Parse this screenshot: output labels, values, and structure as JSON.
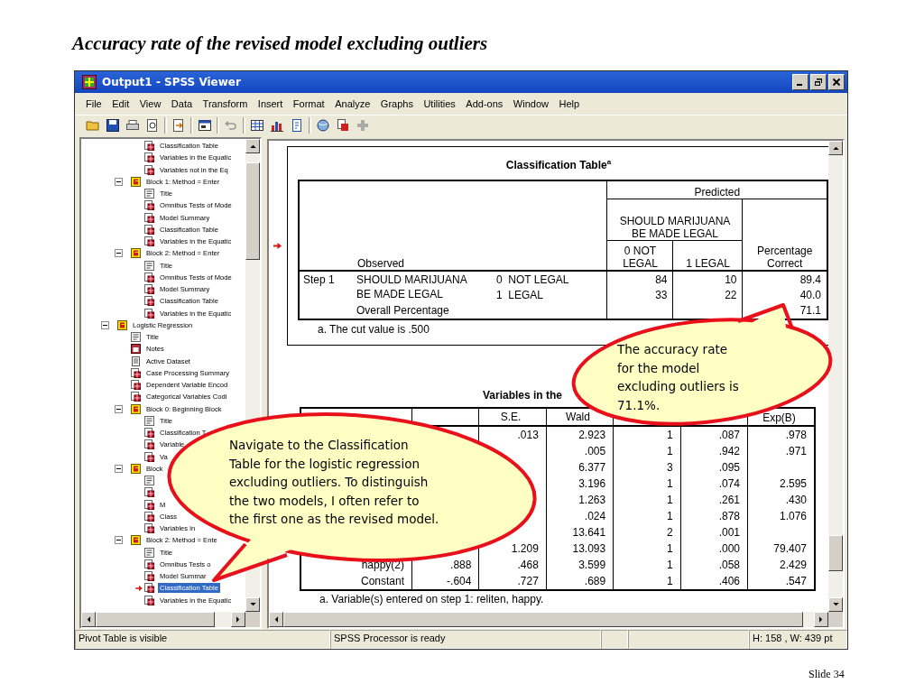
{
  "slide": {
    "title": "Accuracy rate of the revised model excluding outliers",
    "number": "Slide 34"
  },
  "window": {
    "title": "Output1 - SPSS Viewer"
  },
  "menu": [
    "File",
    "Edit",
    "View",
    "Data",
    "Transform",
    "Insert",
    "Format",
    "Analyze",
    "Graphs",
    "Utilities",
    "Add-ons",
    "Window",
    "Help"
  ],
  "tree": {
    "nodes": [
      {
        "children": [
          {
            "children": [
              {
                "kind": "table",
                "label": "Classification Table",
                "selected": false
              },
              {
                "kind": "table",
                "label": "Variables in the Equatic",
                "selected": false
              },
              {
                "kind": "table",
                "label": "Variables not in the Eq",
                "selected": false
              }
            ]
          },
          {
            "kind": "block",
            "label": "Block 1: Method = Enter",
            "selected": false,
            "expanded": true,
            "children": [
              {
                "kind": "title",
                "label": "Title",
                "selected": false
              },
              {
                "kind": "table",
                "label": "Omnibus Tests of Mode",
                "selected": false
              },
              {
                "kind": "table",
                "label": "Model Summary",
                "selected": false
              },
              {
                "kind": "table",
                "label": "Classification Table",
                "selected": false
              },
              {
                "kind": "table",
                "label": "Variables in the Equatic",
                "selected": false
              }
            ]
          },
          {
            "kind": "block",
            "label": "Block 2: Method = Enter",
            "selected": false,
            "expanded": true,
            "children": [
              {
                "kind": "title",
                "label": "Title",
                "selected": false
              },
              {
                "kind": "table",
                "label": "Omnibus Tests of Mode",
                "selected": false
              },
              {
                "kind": "table",
                "label": "Model Summary",
                "selected": false
              },
              {
                "kind": "table",
                "label": "Classification Table",
                "selected": false
              },
              {
                "kind": "table",
                "label": "Variables in the Equatic",
                "selected": false
              }
            ]
          }
        ]
      },
      {
        "kind": "block",
        "label": "Logistic Regression",
        "selected": false,
        "expanded": true,
        "children": [
          {
            "kind": "title",
            "label": "Title",
            "selected": false
          },
          {
            "kind": "notes",
            "label": "Notes",
            "selected": false
          },
          {
            "kind": "text",
            "label": "Active Dataset",
            "selected": false
          },
          {
            "kind": "table",
            "label": "Case Processing Summary",
            "selected": false
          },
          {
            "kind": "table",
            "label": "Dependent Variable Encod",
            "selected": false
          },
          {
            "kind": "table",
            "label": "Categorical Variables Codi",
            "selected": false
          },
          {
            "kind": "block",
            "label": "Block 0: Beginning Block",
            "selected": false,
            "expanded": true,
            "children": [
              {
                "kind": "title",
                "label": "Title",
                "selected": false
              },
              {
                "kind": "table",
                "label": "Classification T",
                "selected": false
              },
              {
                "kind": "table",
                "label": "Variable",
                "selected": false
              },
              {
                "kind": "table",
                "label": "Va",
                "selected": false
              }
            ]
          },
          {
            "kind": "block",
            "label": "Block",
            "selected": false,
            "expanded": true,
            "children": [
              {
                "kind": "title",
                "selected": false
              },
              {
                "kind": "table",
                "selected": false
              },
              {
                "kind": "table",
                "label": "M",
                "selected": false
              },
              {
                "kind": "table",
                "label": "Class",
                "selected": false
              },
              {
                "kind": "table",
                "label": "Variables in",
                "selected": false
              }
            ]
          },
          {
            "kind": "block",
            "label": "Block 2: Method = Ente",
            "selected": false,
            "expanded": true,
            "children": [
              {
                "kind": "title",
                "label": "Title",
                "selected": false
              },
              {
                "kind": "table",
                "label": "Omnibus Tests o",
                "selected": false
              },
              {
                "kind": "table",
                "label": "Model Summar",
                "selected": false
              },
              {
                "kind": "table",
                "label": "Classification Table",
                "selected": true
              },
              {
                "kind": "table",
                "label": "Variables in the Equatic",
                "selected": false
              }
            ]
          }
        ]
      }
    ]
  },
  "classification_table": {
    "current": true,
    "title": "Classification Table$^{a}$",
    "observed": "Observed",
    "predicted": "Predicted",
    "variable": "SHOULD MARIJUANA BE MADE LEGAL",
    "categories": [
      "0  NOT LEGAL",
      "1  LEGAL"
    ],
    "percent": "Percentage Correct",
    "step": "Step 1",
    "row_variable": "SHOULD MARIJUANA BE MADE LEGAL",
    "rows": [
      {
        "category": "0  NOT LEGAL",
        "values": [
          "84",
          "10",
          "89.4"
        ]
      },
      {
        "category": "1  LEGAL",
        "values": [
          "33",
          "22",
          "40.0"
        ]
      }
    ],
    "overall": {
      "label": "Overall Percentage",
      "value": "71.1"
    },
    "footnote": "a. The cut value is .500"
  },
  "variables_table": {
    "title": "Variables in the",
    "columns": [
      null,
      "S.E.",
      "Wald",
      null,
      null,
      "Exp(B)"
    ],
    "rows": [
      {
        "label": null,
        "cells": [
          null,
          ".013",
          "2.923",
          "1",
          ".087",
          ".978"
        ]
      },
      {
        "label": null,
        "cells": [
          null,
          null,
          ".005",
          "1",
          ".942",
          ".971"
        ]
      },
      {
        "label": null,
        "cells": [
          null,
          null,
          "6.377",
          "3",
          ".095",
          null
        ]
      },
      {
        "label": null,
        "cells": [
          null,
          null,
          "3.196",
          "1",
          ".074",
          "2.595"
        ]
      },
      {
        "label": null,
        "cells": [
          null,
          null,
          "1.263",
          "1",
          ".261",
          ".430"
        ]
      },
      {
        "label": null,
        "cells": [
          null,
          null,
          ".024",
          "1",
          ".878",
          "1.076"
        ]
      },
      {
        "label": null,
        "cells": [
          null,
          null,
          "13.641",
          "2",
          ".001",
          null
        ]
      },
      {
        "label": null,
        "cells": [
          null,
          "1.209",
          "13.093",
          "1",
          ".000",
          "79.407"
        ]
      },
      {
        "label": "happy(2)",
        "cells": [
          ".888",
          ".468",
          "3.599",
          "1",
          ".058",
          "2.429"
        ]
      },
      {
        "label": "Constant",
        "cells": [
          "-.604",
          ".727",
          ".689",
          "1",
          ".406",
          ".547"
        ]
      }
    ],
    "footnote": "a. Variable(s) entered on step 1: reliten, happy."
  },
  "status_bar": [
    "Pivot Table is visible",
    "SPSS Processor is ready",
    "H: 158 , W: 439 pt"
  ],
  "callouts": [
    {
      "text": "The accuracy rate\nfor the model\nexcluding outliers is\n71.1%."
    },
    {
      "text": "Navigate to the Classification\nTable for the logistic regression\nexcluding outliers. To distinguish\nthe two models, I often refer to\nthe first one as the revised model."
    }
  ]
}
